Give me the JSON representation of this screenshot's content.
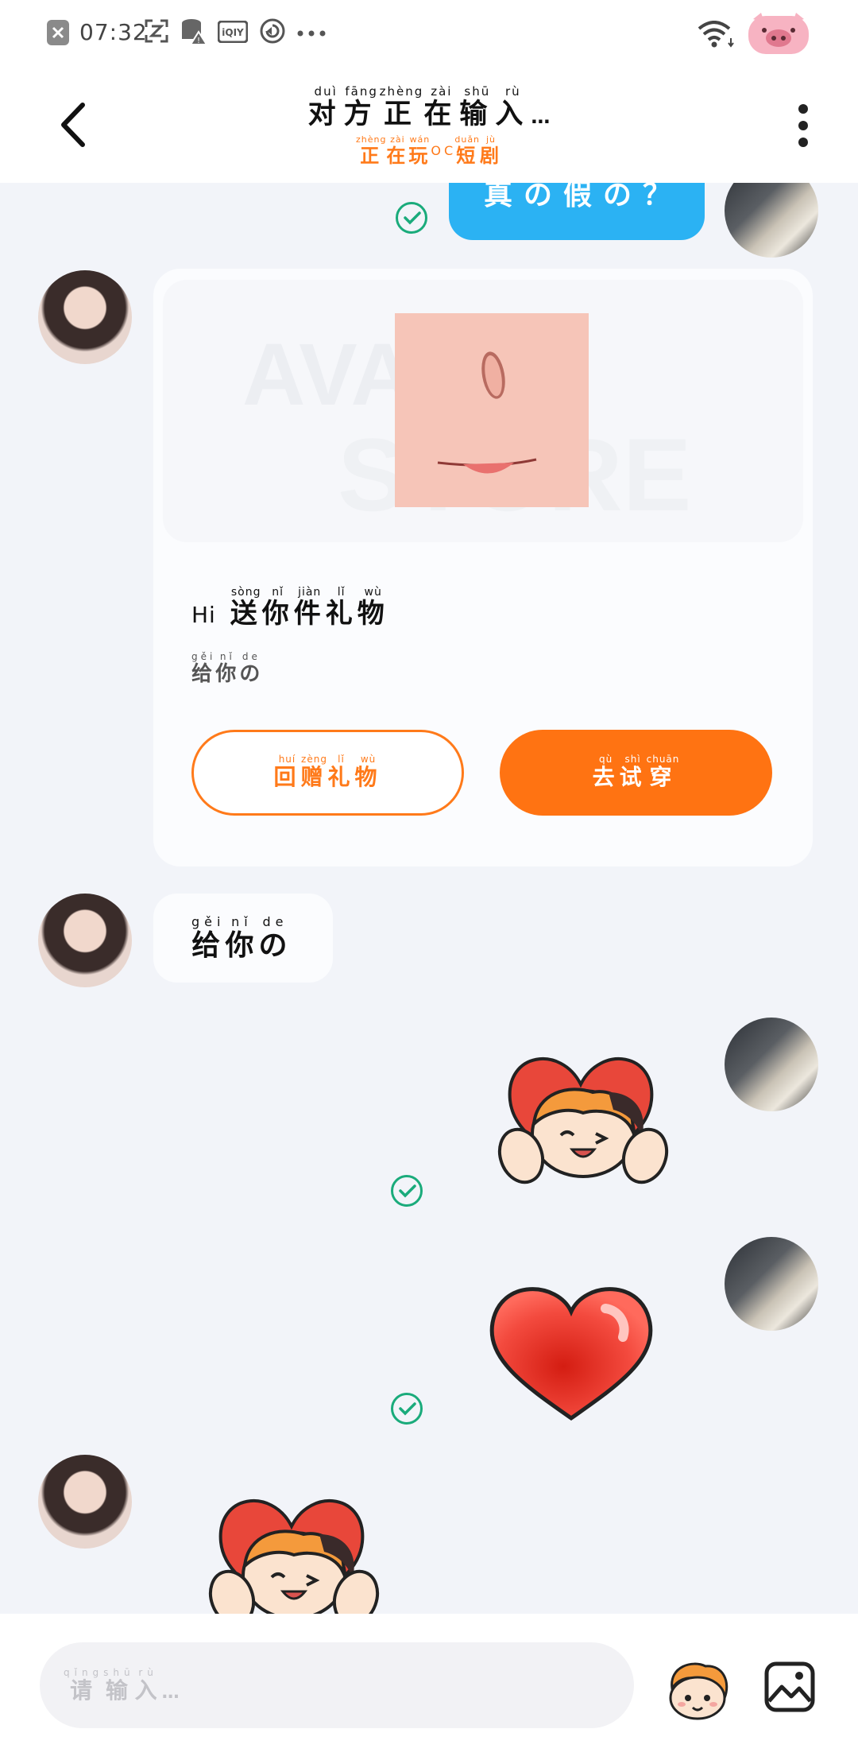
{
  "status_bar": {
    "time": "07:32",
    "left_icons": [
      "app-close-icon",
      "scan-icon",
      "storage-warning-icon",
      "iqiyi-icon",
      "sync-icon",
      "more-dots-icon"
    ],
    "right_icons": [
      "wifi-icon",
      "pig-avatar-icon"
    ]
  },
  "header": {
    "title_chars": [
      {
        "ch": "对",
        "py": "duì"
      },
      {
        "ch": "方",
        "py": "fāng"
      },
      {
        "ch": "正",
        "py": "zhèng"
      },
      {
        "ch": "在",
        "py": "zài"
      },
      {
        "ch": "输",
        "py": "shū"
      },
      {
        "ch": "入",
        "py": "rù"
      }
    ],
    "title_suffix": "…",
    "subtitle_chars_a": [
      {
        "ch": "正",
        "py": "zhèng"
      },
      {
        "ch": "在",
        "py": "zài"
      },
      {
        "ch": "玩",
        "py": "wán"
      }
    ],
    "subtitle_sup": "OC",
    "subtitle_chars_b": [
      {
        "ch": "短",
        "py": "duǎn"
      },
      {
        "ch": "剧",
        "py": "jù"
      }
    ],
    "back_icon": "chevron-left-icon",
    "menu_icon": "vertical-dots-icon"
  },
  "messages": {
    "top_bubble_text": "真の假の？",
    "gift_card": {
      "watermark_line1": "AVATAR",
      "watermark_line2": "STORE",
      "prefix": "Hi",
      "line1_chars": [
        {
          "ch": "送",
          "py": "sòng"
        },
        {
          "ch": "你",
          "py": "nǐ"
        },
        {
          "ch": "件",
          "py": "jiàn"
        },
        {
          "ch": "礼",
          "py": "lǐ"
        },
        {
          "ch": "物",
          "py": "wù"
        }
      ],
      "line2_chars": [
        {
          "ch": "给",
          "py": "gěi"
        },
        {
          "ch": "你",
          "py": "nǐ"
        },
        {
          "ch": "の",
          "py": "de"
        }
      ],
      "button_return_chars": [
        {
          "ch": "回",
          "py": "huí"
        },
        {
          "ch": "赠",
          "py": "zèng"
        },
        {
          "ch": "礼",
          "py": "lǐ"
        },
        {
          "ch": "物",
          "py": "wù"
        }
      ],
      "button_try_chars": [
        {
          "ch": "去",
          "py": "qù"
        },
        {
          "ch": "试",
          "py": "shì"
        },
        {
          "ch": "穿",
          "py": "chuān"
        }
      ]
    },
    "text_bubble_chars": [
      {
        "ch": "给",
        "py": "gěi"
      },
      {
        "ch": "你",
        "py": "nǐ"
      },
      {
        "ch": "の",
        "py": "de"
      }
    ],
    "sticker_names": [
      "heart-hug-sticker",
      "red-heart-sticker",
      "heart-hug-sticker"
    ]
  },
  "input_bar": {
    "placeholder_chars": [
      {
        "ch": "请",
        "py": "qǐng"
      },
      {
        "ch": "输",
        "py": "shū"
      },
      {
        "ch": "入",
        "py": "rù"
      }
    ],
    "placeholder_suffix": "…",
    "emoji_icon": "mascot-face-icon",
    "image_icon": "image-icon"
  },
  "colors": {
    "accent_orange": "#ff7312",
    "check_green": "#1aab7b",
    "bubble_blue": "#2bb2f3",
    "chat_bg": "#f2f4f9"
  }
}
